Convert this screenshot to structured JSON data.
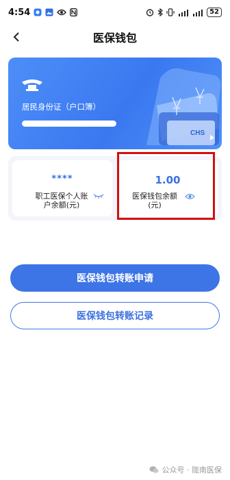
{
  "status_bar": {
    "time": "4:54",
    "network": "᳟",
    "signal_left": "▁▃▅",
    "signal_right": "▁▃▅",
    "battery": "52"
  },
  "nav": {
    "title": "医保钱包"
  },
  "card": {
    "id_label": "居民身份证（户口簿）",
    "logo_text": "CHS"
  },
  "balance": {
    "personal": {
      "value": "****",
      "label": "职工医保个人账户余额(元)"
    },
    "wallet": {
      "value": "1.00",
      "label": "医保钱包余额(元)"
    }
  },
  "buttons": {
    "transfer_apply": "医保钱包转账申请",
    "transfer_record": "医保钱包转账记录"
  },
  "watermark": {
    "text": "公众号 · 陇南医保"
  },
  "colors": {
    "primary": "#3d74e6",
    "card": "#4a87f5",
    "highlight": "#d40e0e"
  }
}
